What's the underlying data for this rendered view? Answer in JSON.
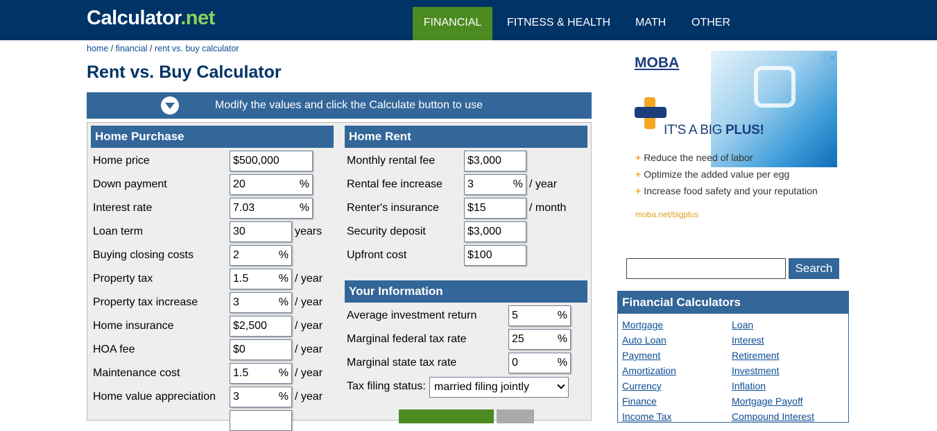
{
  "header": {
    "logo_main": "Calculator",
    "logo_suffix": ".net",
    "nav": [
      "FINANCIAL",
      "FITNESS & HEALTH",
      "MATH",
      "OTHER"
    ]
  },
  "breadcrumb": {
    "home": "home",
    "financial": "financial",
    "current": "rent vs. buy calculator"
  },
  "title": "Rent vs. Buy Calculator",
  "banner": "Modify the values and click the Calculate button to use",
  "purchase": {
    "heading": "Home Purchase",
    "rows": [
      {
        "label": "Home price",
        "value": "$500,000",
        "unit": "",
        "after": ""
      },
      {
        "label": "Down payment",
        "value": "20",
        "unit": "%",
        "after": ""
      },
      {
        "label": "Interest rate",
        "value": "7.03",
        "unit": "%",
        "after": ""
      },
      {
        "label": "Loan term",
        "value": "30",
        "unit": "",
        "after": "years"
      },
      {
        "label": "Buying closing costs",
        "value": "2",
        "unit": "%",
        "after": ""
      },
      {
        "label": "Property tax",
        "value": "1.5",
        "unit": "%",
        "after": "/ year"
      },
      {
        "label": "Property tax increase",
        "value": "3",
        "unit": "%",
        "after": "/ year"
      },
      {
        "label": "Home insurance",
        "value": "$2,500",
        "unit": "",
        "after": "/ year"
      },
      {
        "label": "HOA fee",
        "value": "$0",
        "unit": "",
        "after": "/ year"
      },
      {
        "label": "Maintenance cost",
        "value": "1.5",
        "unit": "%",
        "after": "/ year"
      },
      {
        "label": "Home value appreciation",
        "value": "3",
        "unit": "%",
        "after": "/ year"
      }
    ]
  },
  "rent": {
    "heading": "Home Rent",
    "rows": [
      {
        "label": "Monthly rental fee",
        "value": "$3,000",
        "unit": "",
        "after": ""
      },
      {
        "label": "Rental fee increase",
        "value": "3",
        "unit": "%",
        "after": "/ year"
      },
      {
        "label": "Renter's insurance",
        "value": "$15",
        "unit": "",
        "after": "/ month"
      },
      {
        "label": "Security deposit",
        "value": "$3,000",
        "unit": "",
        "after": ""
      },
      {
        "label": "Upfront cost",
        "value": "$100",
        "unit": "",
        "after": ""
      }
    ]
  },
  "info": {
    "heading": "Your Information",
    "rows": [
      {
        "label": "Average investment return",
        "value": "5",
        "unit": "%"
      },
      {
        "label": "Marginal federal tax rate",
        "value": "25",
        "unit": "%"
      },
      {
        "label": "Marginal state tax rate",
        "value": "0",
        "unit": "%"
      }
    ],
    "filing_label": "Tax filing status:",
    "filing_value": "married filing jointly"
  },
  "ad": {
    "brand": "MOBA",
    "headline_a": "IT'S A BIG ",
    "headline_b": "PLUS!",
    "bullets": [
      "Reduce the need of labor",
      "Optimize the added value per egg",
      "Increase food safety and your reputation"
    ],
    "url": "moba.net/bigplus"
  },
  "search": {
    "button": "Search"
  },
  "financial": {
    "heading": "Financial Calculators",
    "left": [
      "Mortgage",
      "Auto Loan",
      "Payment",
      "Amortization",
      "Currency",
      "Finance",
      "Income Tax"
    ],
    "right": [
      "Loan",
      "Interest",
      "Retirement",
      "Investment",
      "Inflation",
      "Mortgage Payoff",
      "Compound Interest"
    ]
  }
}
